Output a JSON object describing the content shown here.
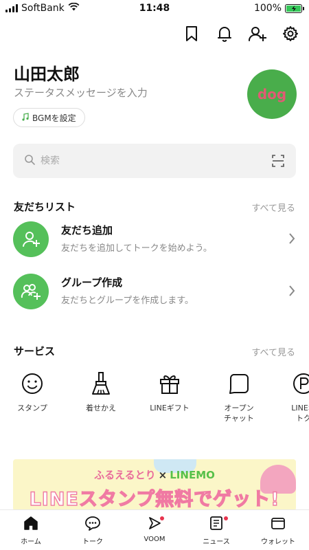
{
  "status_bar": {
    "carrier": "SoftBank",
    "time": "11:48",
    "battery": "100%"
  },
  "header": {
    "icons": [
      "bookmark-icon",
      "bell-icon",
      "add-friend-icon",
      "gear-icon"
    ]
  },
  "profile": {
    "name": "山田太郎",
    "status_message": "ステータスメッセージを入力",
    "bgm_label": "BGMを設定",
    "avatar_text": "dog",
    "avatar_color": "#49ad4b"
  },
  "search": {
    "placeholder": "検索"
  },
  "friends": {
    "title": "友だちリスト",
    "see_all": "すべて見る",
    "items": [
      {
        "title": "友だち追加",
        "subtitle": "友だちを追加してトークを始めよう。"
      },
      {
        "title": "グループ作成",
        "subtitle": "友だちとグループを作成します。"
      }
    ]
  },
  "services": {
    "title": "サービス",
    "see_all": "すべて見る",
    "items": [
      {
        "label": "スタンプ",
        "icon": "smiley-icon"
      },
      {
        "label": "着せかえ",
        "icon": "brush-icon"
      },
      {
        "label": "LINEギフト",
        "icon": "gift-icon"
      },
      {
        "label": "オープン\nチャット",
        "icon": "open-chat-icon"
      },
      {
        "label": "LINEポ\nトク",
        "icon": "points-icon"
      }
    ]
  },
  "banner": {
    "line1_a": "ふるえるとり",
    "line1_x": "×",
    "line1_b": "LINEMO",
    "line2": "LINEスタンプ無料でゲット!"
  },
  "tabbar": {
    "items": [
      {
        "label": "ホーム",
        "icon": "home-icon",
        "active": true
      },
      {
        "label": "トーク",
        "icon": "chat-icon"
      },
      {
        "label": "VOOM",
        "icon": "voom-icon",
        "badge": true
      },
      {
        "label": "ニュース",
        "icon": "news-icon",
        "badge": true
      },
      {
        "label": "ウォレット",
        "icon": "wallet-icon"
      }
    ]
  },
  "colors": {
    "accent": "#55c05a",
    "badge": "#e8344e"
  }
}
